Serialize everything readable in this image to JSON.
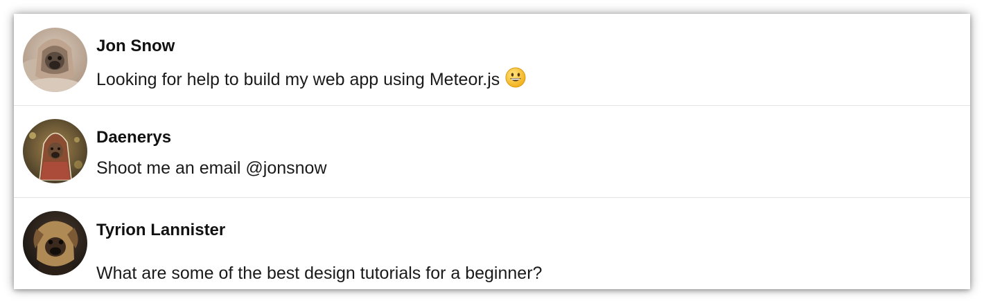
{
  "conversations": [
    {
      "name": "Jon Snow",
      "message": "Looking for help to build my web app using Meteor.js",
      "emoji": "grinning-face-emoji"
    },
    {
      "name": "Daenerys",
      "message": "Shoot me an email @jonsnow"
    },
    {
      "name": "Tyrion Lannister",
      "message": "What are some of the best design tutorials for a beginner?"
    }
  ],
  "colors": {
    "divider": "#e3e3e3",
    "text": "#1a1a1a",
    "name": "#111111"
  }
}
